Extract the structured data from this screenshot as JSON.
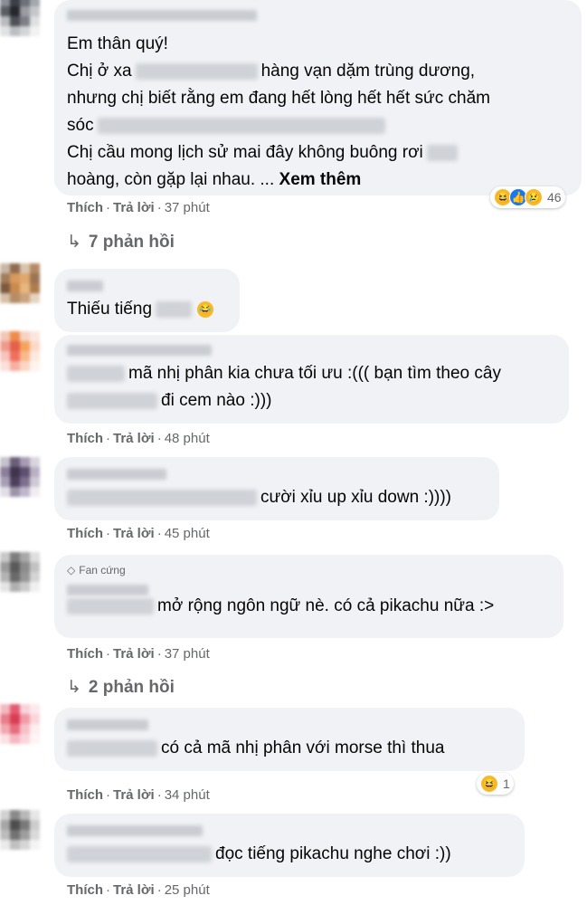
{
  "comments": [
    {
      "lines": [
        "Em thân quý!",
        "Chị ở xa",
        "hàng vạn dặm trùng dương,",
        "nhưng chị biết rằng em đang hết lòng hết hết sức chăm",
        "sóc",
        "Chị cầu mong lịch sử mai đây không buông rơi",
        "hoàng, còn gặp lại nhau. ..."
      ],
      "see_more": "Xem thêm",
      "like": "Thích",
      "reply": "Trả lời",
      "time": "37 phút",
      "reaction_count": "46",
      "replies": "7 phản hồi"
    },
    {
      "text": "Thiếu tiếng"
    },
    {
      "text": "mã nhị phân kia chưa tối ưu :((( bạn tìm theo cây",
      "text2": "đi cem nào :)))",
      "like": "Thích",
      "reply": "Trả lời",
      "time": "48 phút"
    },
    {
      "text": "cười xỉu up xỉu down :))))",
      "like": "Thích",
      "reply": "Trả lời",
      "time": "45 phút"
    },
    {
      "badge": "Fan cứng",
      "text": "mở rộng ngôn ngữ nè. có cả pikachu nữa :>",
      "like": "Thích",
      "reply": "Trả lời",
      "time": "37 phút",
      "replies": "2 phản hồi"
    },
    {
      "text": "có cả mã nhị phân với morse thì thua",
      "like": "Thích",
      "reply": "Trả lời",
      "time": "34 phút",
      "reaction_count": "1"
    },
    {
      "text": "đọc tiếng pikachu nghe chơi :))",
      "like": "Thích",
      "reply": "Trả lời",
      "time": "25 phút"
    }
  ],
  "icons": {
    "reply_arrow": "reply-arrow-icon",
    "haha": "haha-reaction-icon",
    "like": "like-reaction-icon",
    "sad": "sad-reaction-icon"
  },
  "colors": {
    "bubble": "#f0f2f5",
    "meta": "#65676b",
    "text": "#050505"
  }
}
